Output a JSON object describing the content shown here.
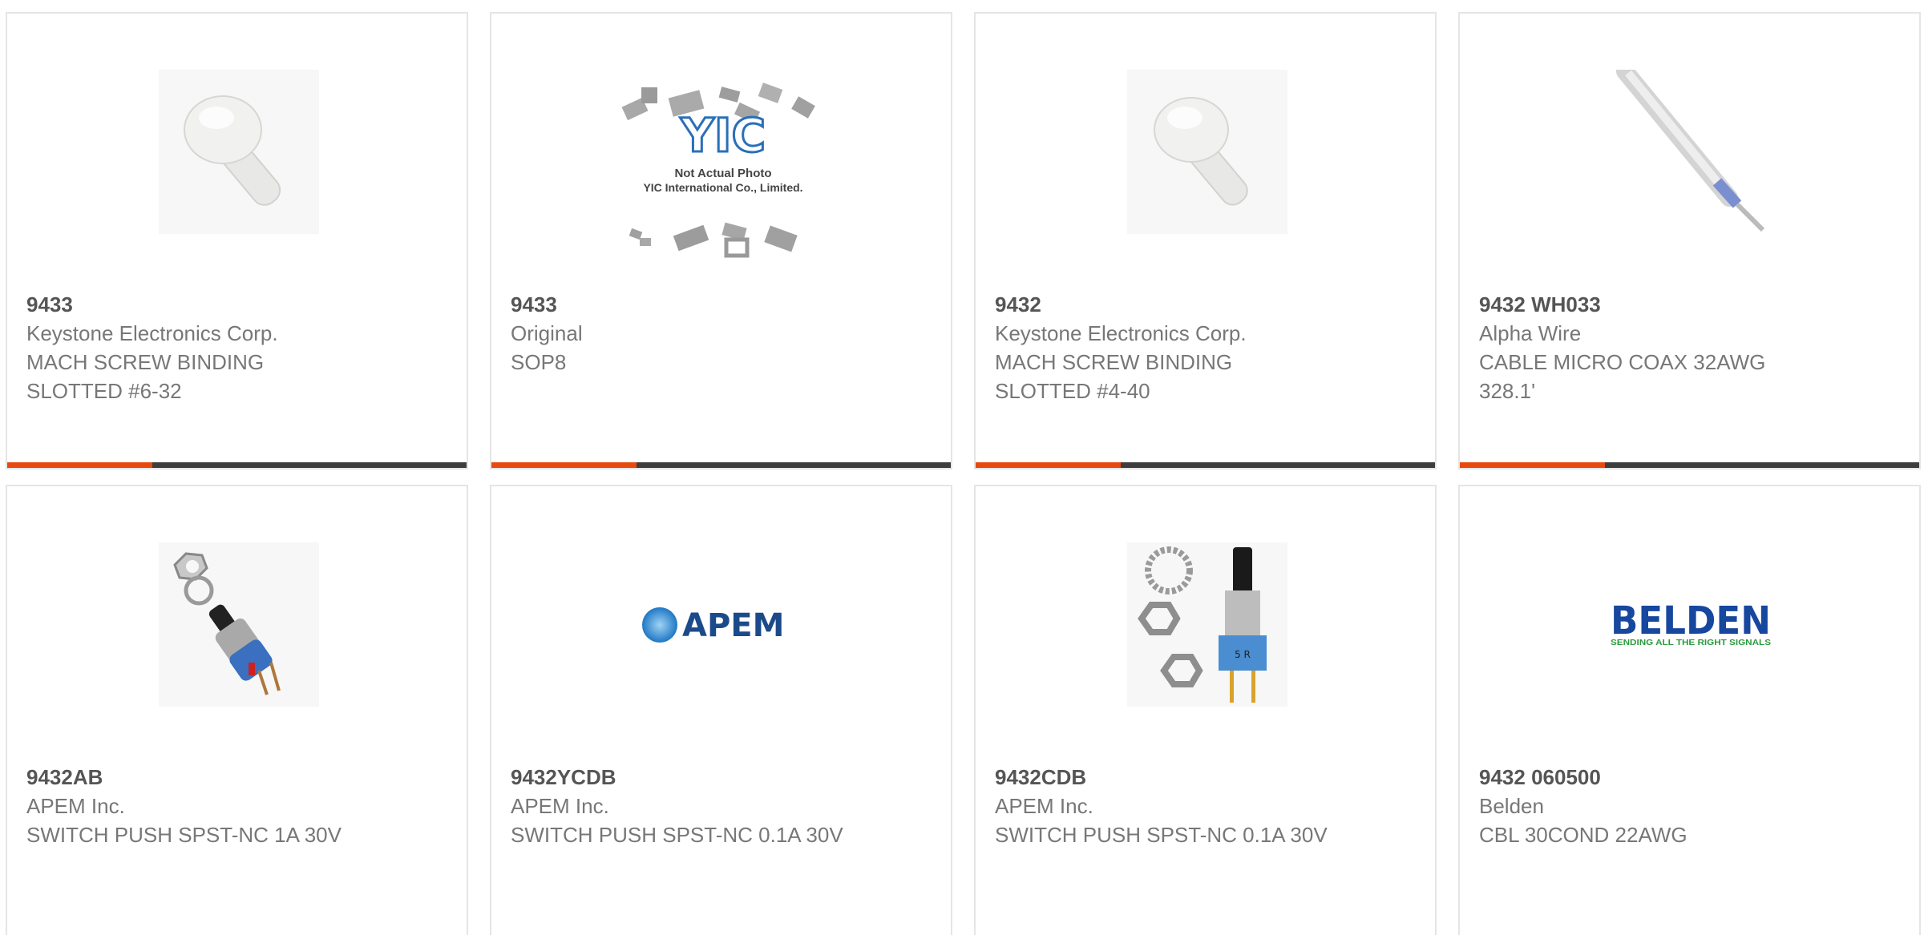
{
  "colors": {
    "accent": "#e8490f",
    "bar": "#3d3d3d",
    "card_border": "#e5e5e5",
    "part_text": "#555555",
    "body_text": "#777777"
  },
  "products": [
    {
      "part_number": "9433",
      "manufacturer": "Keystone Electronics Corp.",
      "description": "MACH SCREW BINDING SLOTTED #6-32",
      "image": "nylon-screw-photo"
    },
    {
      "part_number": "9433",
      "manufacturer": "Original",
      "description": "SOP8",
      "image": "yic-placeholder",
      "image_text": {
        "logo": "YIC",
        "line1": "Not Actual Photo",
        "line2": "YIC International Co., Limited."
      }
    },
    {
      "part_number": "9432",
      "manufacturer": "Keystone Electronics Corp.",
      "description": "MACH SCREW BINDING SLOTTED #4-40",
      "image": "nylon-screw-photo"
    },
    {
      "part_number": "9432 WH033",
      "manufacturer": "Alpha Wire",
      "description": "CABLE MICRO COAX 32AWG 328.1'",
      "image": "coax-cable-photo"
    },
    {
      "part_number": "9432AB",
      "manufacturer": "APEM Inc.",
      "description": "SWITCH PUSH SPST-NC 1A 30V",
      "image": "push-switch-photo"
    },
    {
      "part_number": "9432YCDB",
      "manufacturer": "APEM Inc.",
      "description": "SWITCH PUSH SPST-NC 0.1A 30V",
      "image": "apem-logo",
      "image_text": {
        "logo": "APEM"
      }
    },
    {
      "part_number": "9432CDB",
      "manufacturer": "APEM Inc.",
      "description": "SWITCH PUSH SPST-NC 0.1A 30V",
      "image": "push-switch-nuts-photo"
    },
    {
      "part_number": "9432 060500",
      "manufacturer": "Belden",
      "description": "CBL 30COND 22AWG",
      "image": "belden-logo",
      "image_text": {
        "logo": "BELDEN",
        "tagline": "SENDING ALL THE RIGHT SIGNALS"
      }
    }
  ]
}
